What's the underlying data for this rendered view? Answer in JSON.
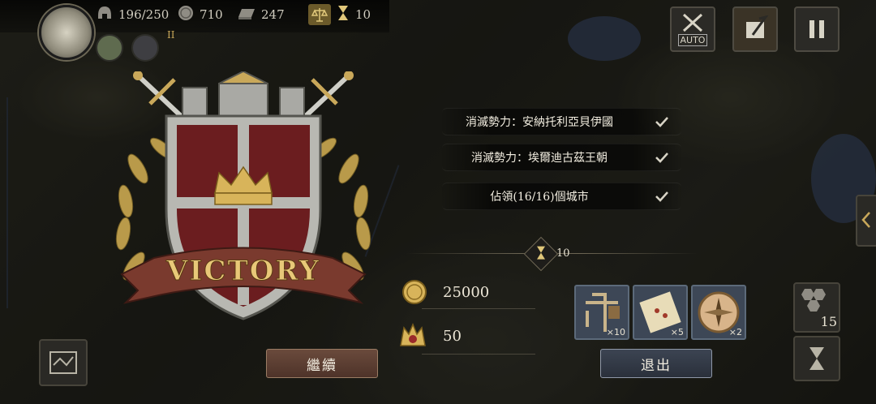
{
  "hud": {
    "soldiers": "196/250",
    "gold": "710",
    "iron": "247",
    "turns": "10",
    "rank_badge": "II"
  },
  "top_buttons": {
    "auto_label": "AUTO"
  },
  "victory": {
    "banner_text": "VICTORY",
    "objectives": [
      {
        "text": "消滅勢力：安納托利亞貝伊國",
        "done": true
      },
      {
        "text": "消滅勢力：埃爾迪古茲王朝",
        "done": true
      },
      {
        "text": "佔領(16/16)個城市",
        "done": true
      }
    ],
    "turns_used": "10",
    "rewards": {
      "gold": "25000",
      "medals": "50",
      "items": [
        {
          "icon": "siege-tower-icon",
          "qty": "×10"
        },
        {
          "icon": "scroll-map-icon",
          "qty": "×5"
        },
        {
          "icon": "compass-icon",
          "qty": "×2"
        }
      ]
    },
    "continue_label": "繼續",
    "exit_label": "退出"
  },
  "side": {
    "unit_count": "15"
  },
  "colors": {
    "shield_red": "#6b1d1f",
    "gold": "#c9a85a",
    "steel": "#b8b8b2"
  }
}
